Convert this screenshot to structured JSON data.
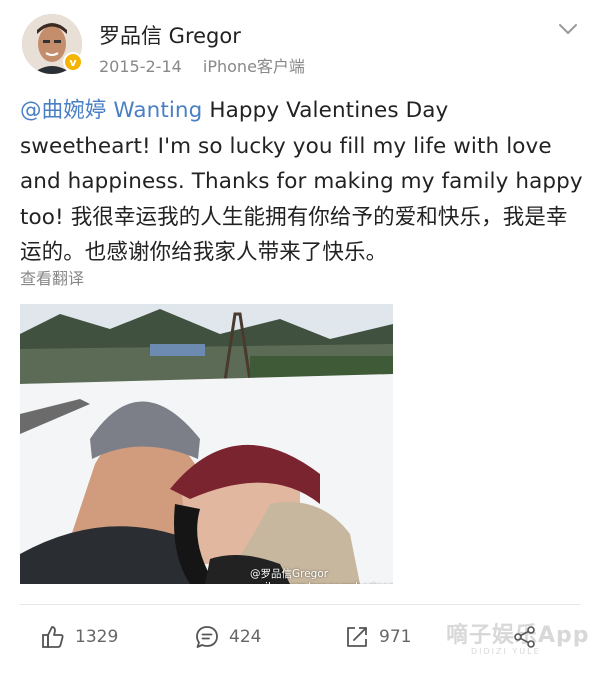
{
  "post": {
    "author": "罗品信 Gregor",
    "date": "2015-2-14",
    "source": "iPhone客户端",
    "mention": "@曲婉婷 Wanting",
    "body": " Happy Valentines Day sweetheart! I'm so lucky you fill my life with love and happiness. Thanks for making my family happy too! 我很幸运我的人生能拥有你给予的爱和快乐，我是幸运的。也感谢你给我家人带来了快乐。",
    "translate_label": "查看翻译",
    "photo_watermark": "@罗品信Gregor weibo.com/gregorrobertson"
  },
  "actions": {
    "likes": "1329",
    "comments": "424",
    "reposts": "971"
  },
  "overlay": {
    "brand": "嘀子娱乐App",
    "brand_sub": "DIDIZI YULE"
  },
  "colors": {
    "mention": "#4a7fc3",
    "verified": "#f5b400",
    "meta_text": "#888888"
  },
  "icons": [
    "chevron-down-icon",
    "verified-badge-icon",
    "like-icon",
    "comment-icon",
    "repost-icon",
    "share-icon"
  ]
}
